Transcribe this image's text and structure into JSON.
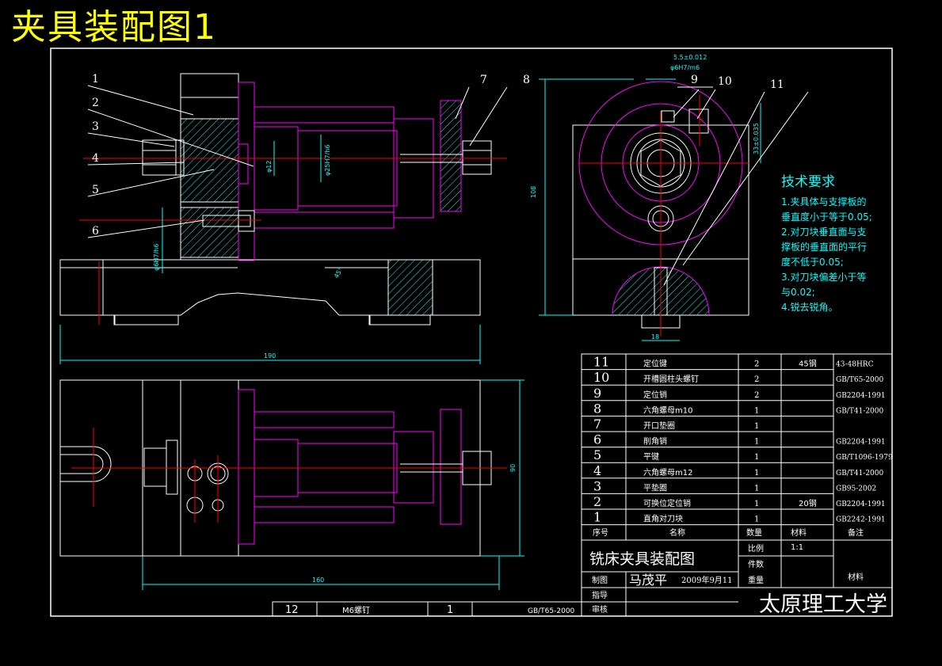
{
  "colors": {
    "background": "#000000",
    "frame": "#ffffff",
    "cyan": "#00ffff",
    "magenta": "#ff00ff",
    "red": "#ff0000",
    "title": "#ffff00",
    "text": "#ffffff"
  },
  "drawing_title": "夹具装配图1",
  "balloons": [
    "1",
    "2",
    "3",
    "4",
    "5",
    "6",
    "7",
    "8",
    "9",
    "10",
    "11"
  ],
  "dimensions": {
    "front_length": "190",
    "top_length": "160",
    "side_height": "108",
    "top_height": "90",
    "key_width": "18",
    "side_offset": "33±0.035",
    "key_slot": "5.5±0.012",
    "fit_small": "φ6H7/m6",
    "fit_pin": "φ25H7/h6",
    "fit_bush": "φ12",
    "fit_base": "φ6H7/h6",
    "angle_note": "45°"
  },
  "requirements": {
    "title": "技术要求",
    "items": [
      "1.夹具体与支撑板的",
      "垂直度小于等于0.05;",
      "2.对刀块垂直面与支",
      "撑板的垂直面的平行",
      "度不低于0.05;",
      "3.对刀块偏差小于等",
      "与0.02;",
      "4.锐去锐角。"
    ]
  },
  "parts_list": {
    "rows": [
      {
        "no": "11",
        "name": "定位键",
        "qty": "2",
        "material": "45钢",
        "note": "43-48HRC"
      },
      {
        "no": "10",
        "name": "开槽圆柱头螺钉",
        "qty": "2",
        "material": "",
        "note": "GB/T65-2000"
      },
      {
        "no": "9",
        "name": "定位销",
        "qty": "2",
        "material": "",
        "note": "GB2204-1991"
      },
      {
        "no": "8",
        "name": "六角螺母m10",
        "qty": "1",
        "material": "",
        "note": "GB/T41-2000"
      },
      {
        "no": "7",
        "name": "开口垫圈",
        "qty": "1",
        "material": "",
        "note": ""
      },
      {
        "no": "6",
        "name": "削角销",
        "qty": "1",
        "material": "",
        "note": "GB2204-1991"
      },
      {
        "no": "5",
        "name": "平键",
        "qty": "1",
        "material": "",
        "note": "GB/T1096-1979"
      },
      {
        "no": "4",
        "name": "六角螺母m12",
        "qty": "1",
        "material": "",
        "note": "GB/T41-2000"
      },
      {
        "no": "3",
        "name": "平垫圈",
        "qty": "1",
        "material": "",
        "note": "GB95-2002"
      },
      {
        "no": "2",
        "name": "可换位定位销",
        "qty": "1",
        "material": "20钢",
        "note": "GB2204-1991"
      },
      {
        "no": "1",
        "name": "直角对刀块",
        "qty": "1",
        "material": "",
        "note": "GB2242-1991"
      }
    ],
    "header": {
      "no": "序号",
      "name": "名称",
      "qty": "数量",
      "material": "材料",
      "note": "备注"
    },
    "extra_row": {
      "no": "12",
      "name": "M6螺钉",
      "qty": "1",
      "note": "GB/T65-2000"
    }
  },
  "title_block": {
    "drawing_name": "铣床夹具装配图",
    "scale_label": "比例",
    "scale_value": "1:1",
    "pieces_label": "件数",
    "drawn_label": "制图",
    "drawn_by": "马茂平",
    "date": "2009年9月11",
    "weight_label": "重量",
    "material_label": "材料",
    "guide_label": "指导",
    "review_label": "审核",
    "school": "太原理工大学"
  }
}
